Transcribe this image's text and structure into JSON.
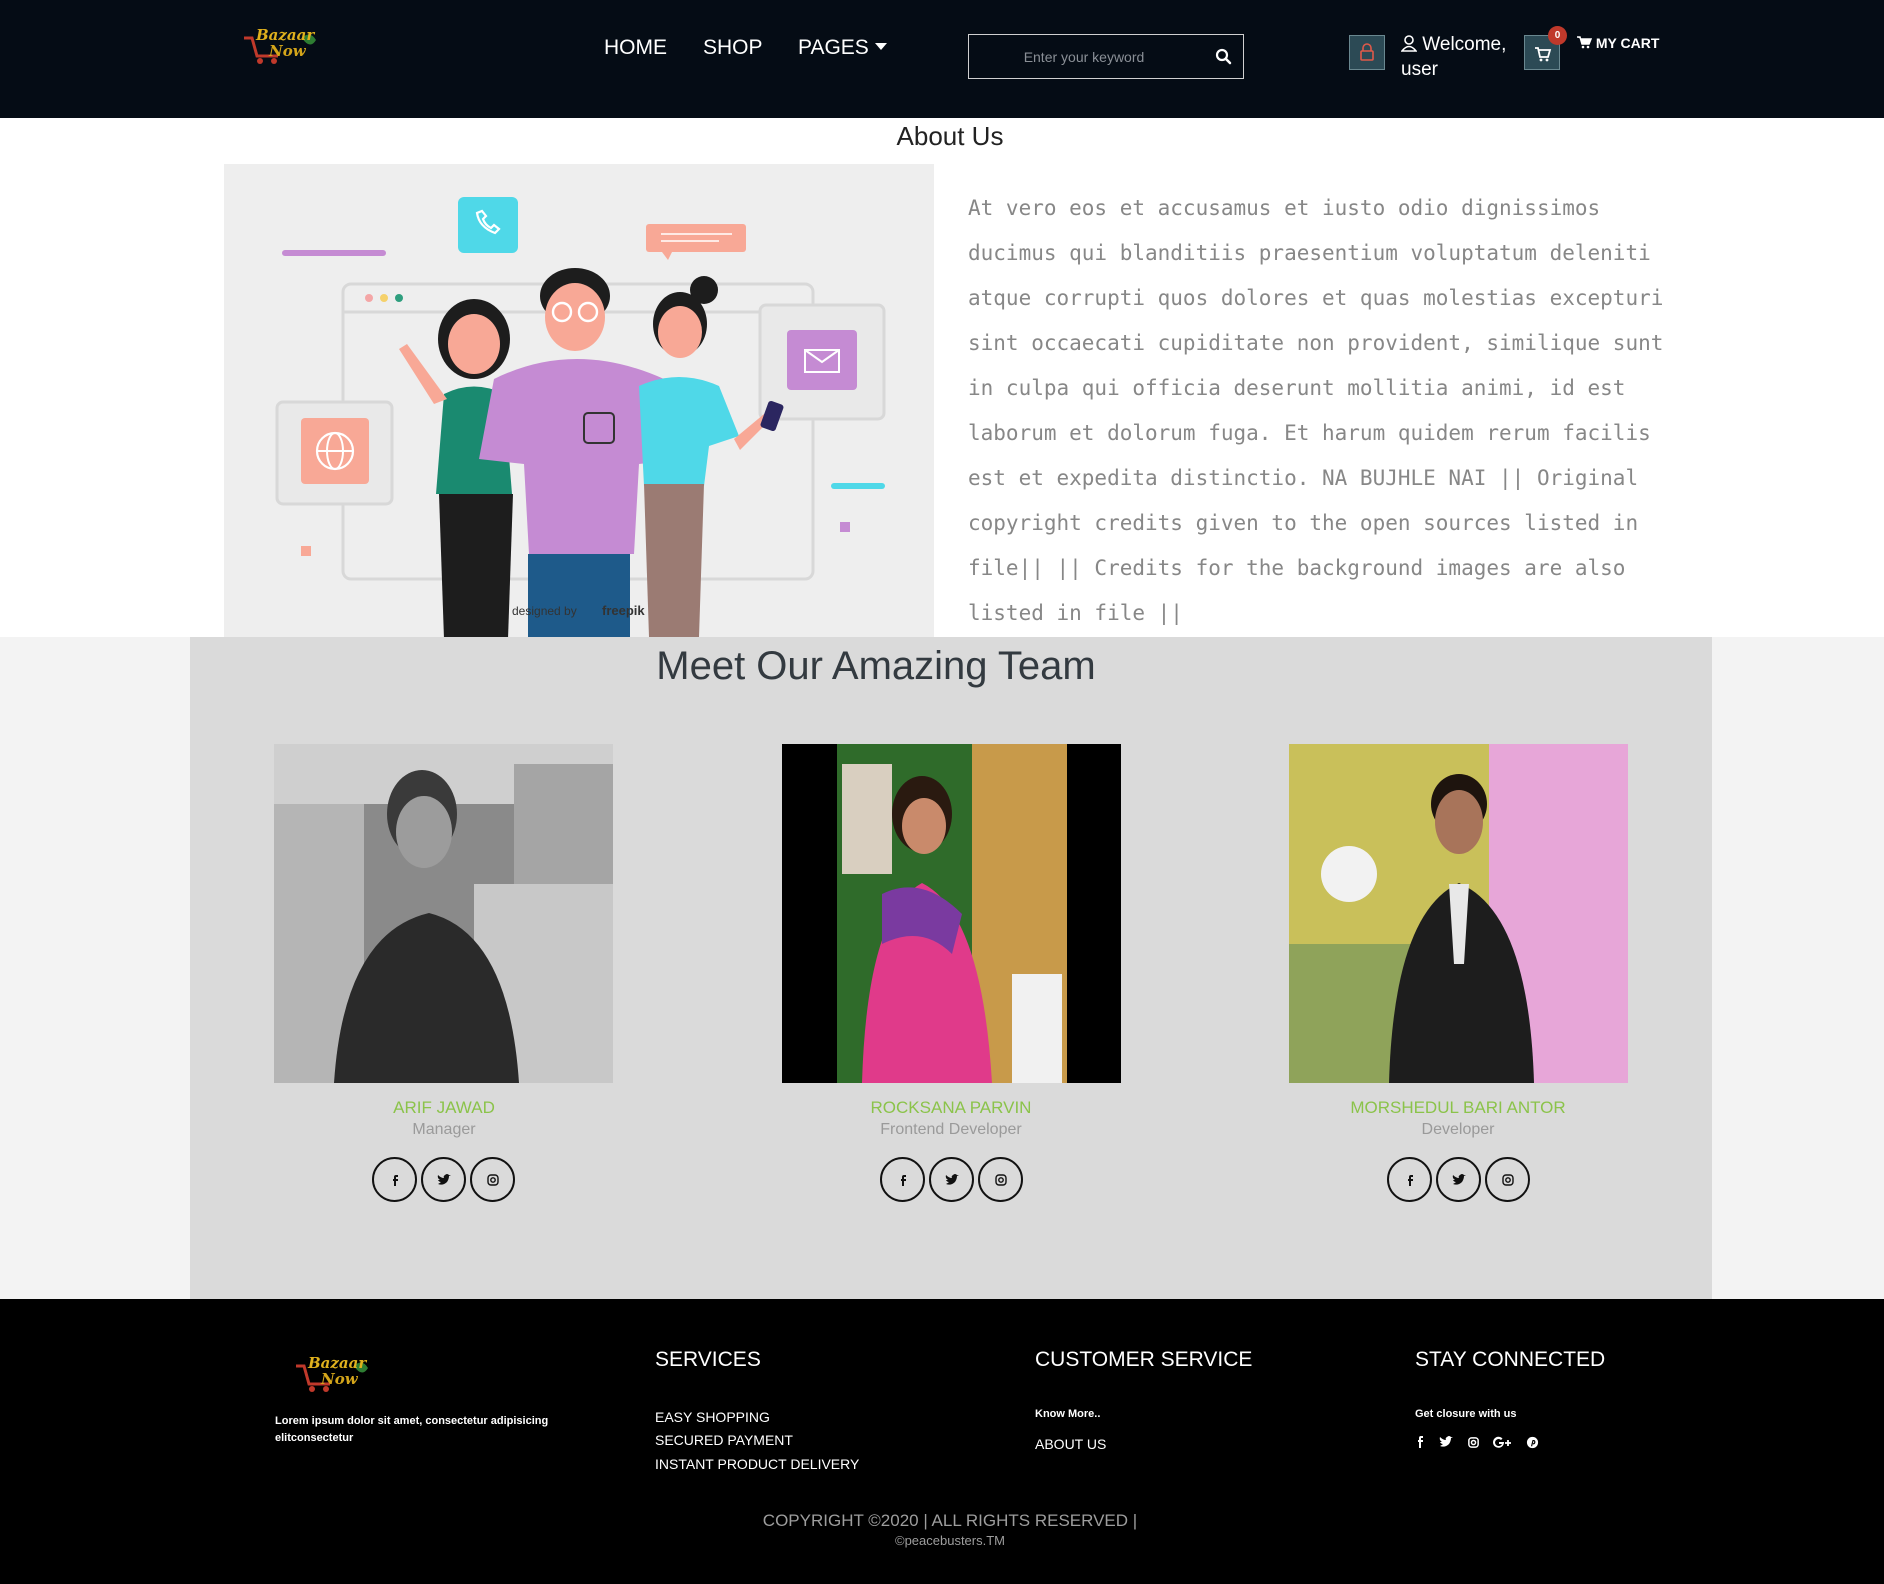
{
  "header": {
    "logo_text_1": "Bazaar",
    "logo_text_2": "Now",
    "nav": {
      "home": "HOME",
      "shop": "SHOP",
      "pages": "PAGES"
    },
    "search_placeholder": "Enter your keyword",
    "welcome_1": "Welcome,",
    "welcome_2": "user",
    "cart_count": "0",
    "cart_label": "MY CART"
  },
  "about": {
    "title": "About Us",
    "image_credit": "designed by",
    "image_credit_brand": "freepik",
    "text": "At vero eos et accusamus et iusto odio dignissimos ducimus qui blanditiis praesentium voluptatum deleniti atque corrupti quos dolores et quas molestias excepturi sint occaecati cupiditate non provident, similique sunt in culpa qui officia deserunt mollitia animi, id est laborum et dolorum fuga. Et harum quidem rerum facilis est et expedita distinctio. NA BUJHLE NAI || Original copyright credits given to the open sources listed in file|| || Credits for the background images are also listed in file ||"
  },
  "team": {
    "title": "Meet Our Amazing Team",
    "members": [
      {
        "name": "ARIF JAWAD",
        "role": "Manager"
      },
      {
        "name": "ROCKSANA PARVIN",
        "role": "Frontend Developer"
      },
      {
        "name": "MORSHEDUL BARI ANTOR",
        "role": "Developer"
      }
    ],
    "social_icons": [
      "facebook-icon",
      "twitter-icon",
      "instagram-icon"
    ]
  },
  "footer": {
    "logo_text_1": "Bazaar",
    "logo_text_2": "Now",
    "description": "Lorem ipsum dolor sit amet, consectetur adipisicing elitconsectetur",
    "services": {
      "heading": "SERVICES",
      "items": [
        "EASY SHOPPING",
        "SECURED PAYMENT",
        "INSTANT PRODUCT DELIVERY"
      ]
    },
    "customer_service": {
      "heading": "CUSTOMER SERVICE",
      "know_more": "Know More..",
      "about": "ABOUT US"
    },
    "stay_connected": {
      "heading": "STAY CONNECTED",
      "subtitle": "Get closure with us",
      "icons": [
        "facebook-icon",
        "twitter-icon",
        "instagram-icon",
        "google-plus-icon",
        "pinterest-icon"
      ]
    },
    "copyright": "COPYRIGHT ©2020 | ALL RIGHTS RESERVED |",
    "trademark": "©peacebusters.TM"
  },
  "colors": {
    "header_bg": "#050c15",
    "accent_green": "#8bc34a",
    "team_bg": "#dadada",
    "footer_bg": "#000000"
  }
}
